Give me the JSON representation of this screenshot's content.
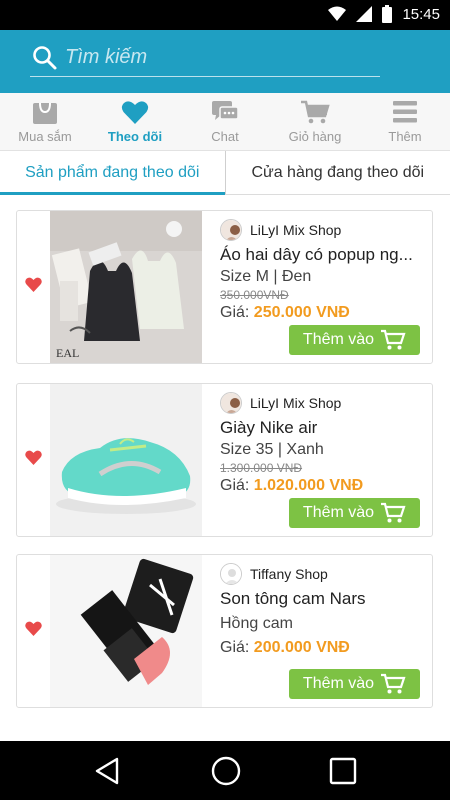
{
  "status_bar": {
    "time": "15:45"
  },
  "search": {
    "placeholder": "Tìm kiếm"
  },
  "nav": {
    "items": [
      {
        "label": "Mua sắm",
        "icon": "shopping-bag-icon"
      },
      {
        "label": "Theo dõi",
        "icon": "heart-icon"
      },
      {
        "label": "Chat",
        "icon": "chat-icon"
      },
      {
        "label": "Giỏ hàng",
        "icon": "cart-icon"
      },
      {
        "label": "Thêm",
        "icon": "menu-icon"
      }
    ],
    "active_index": 1
  },
  "tabs": [
    {
      "label": "Sản phẩm đang theo dõi"
    },
    {
      "label": "Cửa hàng đang theo dõi"
    }
  ],
  "products": [
    {
      "shop": "LiLyI  Mix Shop",
      "name": "Áo hai dây có popup ng...",
      "variant": "Size M | Đen",
      "old_price": "350.000VNĐ",
      "price_label": "Giá:",
      "price": "250.000 VNĐ",
      "add_label": "Thêm vào"
    },
    {
      "shop": "LiLyI  Mix Shop",
      "name": "Giày Nike air",
      "variant": "Size 35 | Xanh",
      "old_price": "1.300.000 VNĐ",
      "price_label": "Giá:",
      "price": "1.020.000 VNĐ",
      "add_label": "Thêm vào"
    },
    {
      "shop": "Tiffany Shop",
      "name": "Son tông cam Nars",
      "variant": "Hồng cam",
      "old_price": "",
      "price_label": "Giá:",
      "price": "200.000 VNĐ",
      "add_label": "Thêm vào"
    }
  ],
  "colors": {
    "accent": "#1f9fc2",
    "price": "#f29b1f",
    "button": "#7dc244",
    "heart": "#e84a4a"
  }
}
